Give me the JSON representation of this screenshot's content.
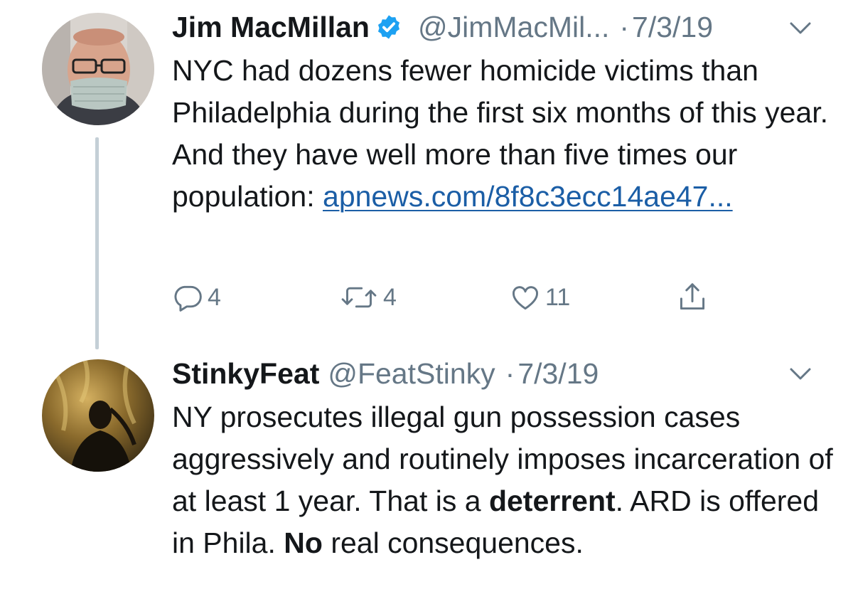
{
  "thread": {
    "tweets": [
      {
        "display_name": "Jim MacMillan",
        "verified": true,
        "handle": "@JimMacMil...",
        "separator": "·",
        "date": "7/3/19",
        "text_before_link": "NYC had dozens fewer homicide victims than Philadelphia during the first six months of this year. And they have well more than five times our population: ",
        "link_text": "apnews.com/8f8c3ecc14ae47...",
        "actions": {
          "reply_count": "4",
          "retweet_count": "4",
          "like_count": "11"
        }
      },
      {
        "display_name": "StinkyFeat",
        "handle": "@FeatStinky",
        "separator": "·",
        "date": "7/3/19",
        "text": {
          "part1": "NY prosecutes illegal gun possession cases aggressively and routinely imposes incarceration of at least 1 year. That is a ",
          "bold1": "deterrent",
          "part2": ". ARD is offered in Phila. ",
          "bold2": "No",
          "part3": " real consequences."
        }
      }
    ]
  },
  "icons": {
    "verified": "verified-badge-icon",
    "caret": "chevron-down-icon",
    "reply": "reply-icon",
    "retweet": "retweet-icon",
    "like": "heart-icon",
    "share": "share-icon"
  },
  "colors": {
    "text": "#14171a",
    "secondary": "#657786",
    "link": "#1b5ea6",
    "verified": "#1da1f2",
    "thread_line": "#c4cfd6"
  }
}
